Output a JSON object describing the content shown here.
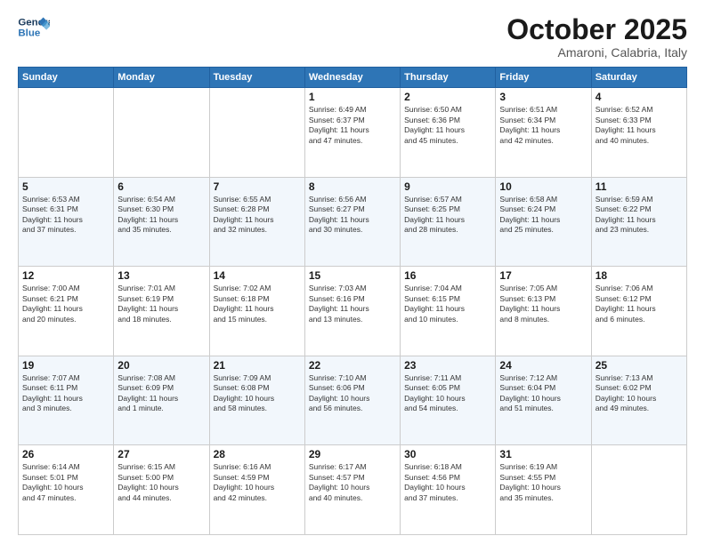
{
  "logo": {
    "line1": "General",
    "line2": "Blue"
  },
  "title": "October 2025",
  "subtitle": "Amaroni, Calabria, Italy",
  "days_of_week": [
    "Sunday",
    "Monday",
    "Tuesday",
    "Wednesday",
    "Thursday",
    "Friday",
    "Saturday"
  ],
  "weeks": [
    [
      {
        "day": "",
        "info": ""
      },
      {
        "day": "",
        "info": ""
      },
      {
        "day": "",
        "info": ""
      },
      {
        "day": "1",
        "info": "Sunrise: 6:49 AM\nSunset: 6:37 PM\nDaylight: 11 hours\nand 47 minutes."
      },
      {
        "day": "2",
        "info": "Sunrise: 6:50 AM\nSunset: 6:36 PM\nDaylight: 11 hours\nand 45 minutes."
      },
      {
        "day": "3",
        "info": "Sunrise: 6:51 AM\nSunset: 6:34 PM\nDaylight: 11 hours\nand 42 minutes."
      },
      {
        "day": "4",
        "info": "Sunrise: 6:52 AM\nSunset: 6:33 PM\nDaylight: 11 hours\nand 40 minutes."
      }
    ],
    [
      {
        "day": "5",
        "info": "Sunrise: 6:53 AM\nSunset: 6:31 PM\nDaylight: 11 hours\nand 37 minutes."
      },
      {
        "day": "6",
        "info": "Sunrise: 6:54 AM\nSunset: 6:30 PM\nDaylight: 11 hours\nand 35 minutes."
      },
      {
        "day": "7",
        "info": "Sunrise: 6:55 AM\nSunset: 6:28 PM\nDaylight: 11 hours\nand 32 minutes."
      },
      {
        "day": "8",
        "info": "Sunrise: 6:56 AM\nSunset: 6:27 PM\nDaylight: 11 hours\nand 30 minutes."
      },
      {
        "day": "9",
        "info": "Sunrise: 6:57 AM\nSunset: 6:25 PM\nDaylight: 11 hours\nand 28 minutes."
      },
      {
        "day": "10",
        "info": "Sunrise: 6:58 AM\nSunset: 6:24 PM\nDaylight: 11 hours\nand 25 minutes."
      },
      {
        "day": "11",
        "info": "Sunrise: 6:59 AM\nSunset: 6:22 PM\nDaylight: 11 hours\nand 23 minutes."
      }
    ],
    [
      {
        "day": "12",
        "info": "Sunrise: 7:00 AM\nSunset: 6:21 PM\nDaylight: 11 hours\nand 20 minutes."
      },
      {
        "day": "13",
        "info": "Sunrise: 7:01 AM\nSunset: 6:19 PM\nDaylight: 11 hours\nand 18 minutes."
      },
      {
        "day": "14",
        "info": "Sunrise: 7:02 AM\nSunset: 6:18 PM\nDaylight: 11 hours\nand 15 minutes."
      },
      {
        "day": "15",
        "info": "Sunrise: 7:03 AM\nSunset: 6:16 PM\nDaylight: 11 hours\nand 13 minutes."
      },
      {
        "day": "16",
        "info": "Sunrise: 7:04 AM\nSunset: 6:15 PM\nDaylight: 11 hours\nand 10 minutes."
      },
      {
        "day": "17",
        "info": "Sunrise: 7:05 AM\nSunset: 6:13 PM\nDaylight: 11 hours\nand 8 minutes."
      },
      {
        "day": "18",
        "info": "Sunrise: 7:06 AM\nSunset: 6:12 PM\nDaylight: 11 hours\nand 6 minutes."
      }
    ],
    [
      {
        "day": "19",
        "info": "Sunrise: 7:07 AM\nSunset: 6:11 PM\nDaylight: 11 hours\nand 3 minutes."
      },
      {
        "day": "20",
        "info": "Sunrise: 7:08 AM\nSunset: 6:09 PM\nDaylight: 11 hours\nand 1 minute."
      },
      {
        "day": "21",
        "info": "Sunrise: 7:09 AM\nSunset: 6:08 PM\nDaylight: 10 hours\nand 58 minutes."
      },
      {
        "day": "22",
        "info": "Sunrise: 7:10 AM\nSunset: 6:06 PM\nDaylight: 10 hours\nand 56 minutes."
      },
      {
        "day": "23",
        "info": "Sunrise: 7:11 AM\nSunset: 6:05 PM\nDaylight: 10 hours\nand 54 minutes."
      },
      {
        "day": "24",
        "info": "Sunrise: 7:12 AM\nSunset: 6:04 PM\nDaylight: 10 hours\nand 51 minutes."
      },
      {
        "day": "25",
        "info": "Sunrise: 7:13 AM\nSunset: 6:02 PM\nDaylight: 10 hours\nand 49 minutes."
      }
    ],
    [
      {
        "day": "26",
        "info": "Sunrise: 6:14 AM\nSunset: 5:01 PM\nDaylight: 10 hours\nand 47 minutes."
      },
      {
        "day": "27",
        "info": "Sunrise: 6:15 AM\nSunset: 5:00 PM\nDaylight: 10 hours\nand 44 minutes."
      },
      {
        "day": "28",
        "info": "Sunrise: 6:16 AM\nSunset: 4:59 PM\nDaylight: 10 hours\nand 42 minutes."
      },
      {
        "day": "29",
        "info": "Sunrise: 6:17 AM\nSunset: 4:57 PM\nDaylight: 10 hours\nand 40 minutes."
      },
      {
        "day": "30",
        "info": "Sunrise: 6:18 AM\nSunset: 4:56 PM\nDaylight: 10 hours\nand 37 minutes."
      },
      {
        "day": "31",
        "info": "Sunrise: 6:19 AM\nSunset: 4:55 PM\nDaylight: 10 hours\nand 35 minutes."
      },
      {
        "day": "",
        "info": ""
      }
    ]
  ]
}
